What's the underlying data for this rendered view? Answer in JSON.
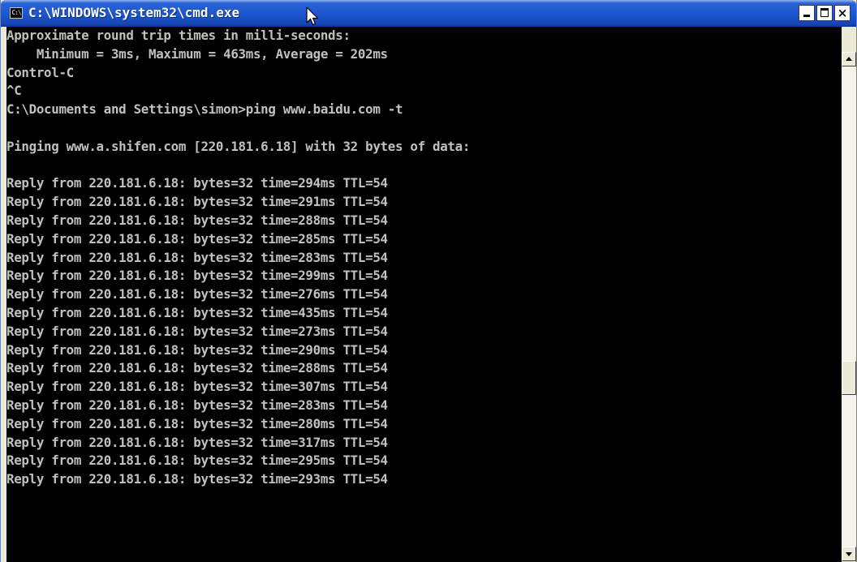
{
  "window": {
    "title": "C:\\WINDOWS\\system32\\cmd.exe",
    "icon_name": "cmd-prompt-icon",
    "icon_text": "C:\\",
    "buttons": {
      "minimize_icon": "minimize-icon",
      "maximize_icon": "maximize-icon",
      "close_label": "×"
    }
  },
  "colors": {
    "titlebar": "#1d56d0",
    "console_bg": "#000000",
    "console_fg": "#c0c0c0",
    "chrome": "#ece9d8"
  },
  "console": {
    "lines": [
      "Approximate round trip times in milli-seconds:",
      "    Minimum = 3ms, Maximum = 463ms, Average = 202ms",
      "Control-C",
      "^C",
      "C:\\Documents and Settings\\simon>ping www.baidu.com -t",
      "",
      "Pinging www.a.shifen.com [220.181.6.18] with 32 bytes of data:",
      "",
      "Reply from 220.181.6.18: bytes=32 time=294ms TTL=54",
      "Reply from 220.181.6.18: bytes=32 time=291ms TTL=54",
      "Reply from 220.181.6.18: bytes=32 time=288ms TTL=54",
      "Reply from 220.181.6.18: bytes=32 time=285ms TTL=54",
      "Reply from 220.181.6.18: bytes=32 time=283ms TTL=54",
      "Reply from 220.181.6.18: bytes=32 time=299ms TTL=54",
      "Reply from 220.181.6.18: bytes=32 time=276ms TTL=54",
      "Reply from 220.181.6.18: bytes=32 time=435ms TTL=54",
      "Reply from 220.181.6.18: bytes=32 time=273ms TTL=54",
      "Reply from 220.181.6.18: bytes=32 time=290ms TTL=54",
      "Reply from 220.181.6.18: bytes=32 time=288ms TTL=54",
      "Reply from 220.181.6.18: bytes=32 time=307ms TTL=54",
      "Reply from 220.181.6.18: bytes=32 time=283ms TTL=54",
      "Reply from 220.181.6.18: bytes=32 time=280ms TTL=54",
      "Reply from 220.181.6.18: bytes=32 time=317ms TTL=54",
      "Reply from 220.181.6.18: bytes=32 time=295ms TTL=54",
      "Reply from 220.181.6.18: bytes=32 time=293ms TTL=54"
    ]
  },
  "scrollbar": {
    "up_icon": "scroll-up-arrow-icon",
    "down_icon": "scroll-down-arrow-icon",
    "position_fraction": 0.66
  }
}
